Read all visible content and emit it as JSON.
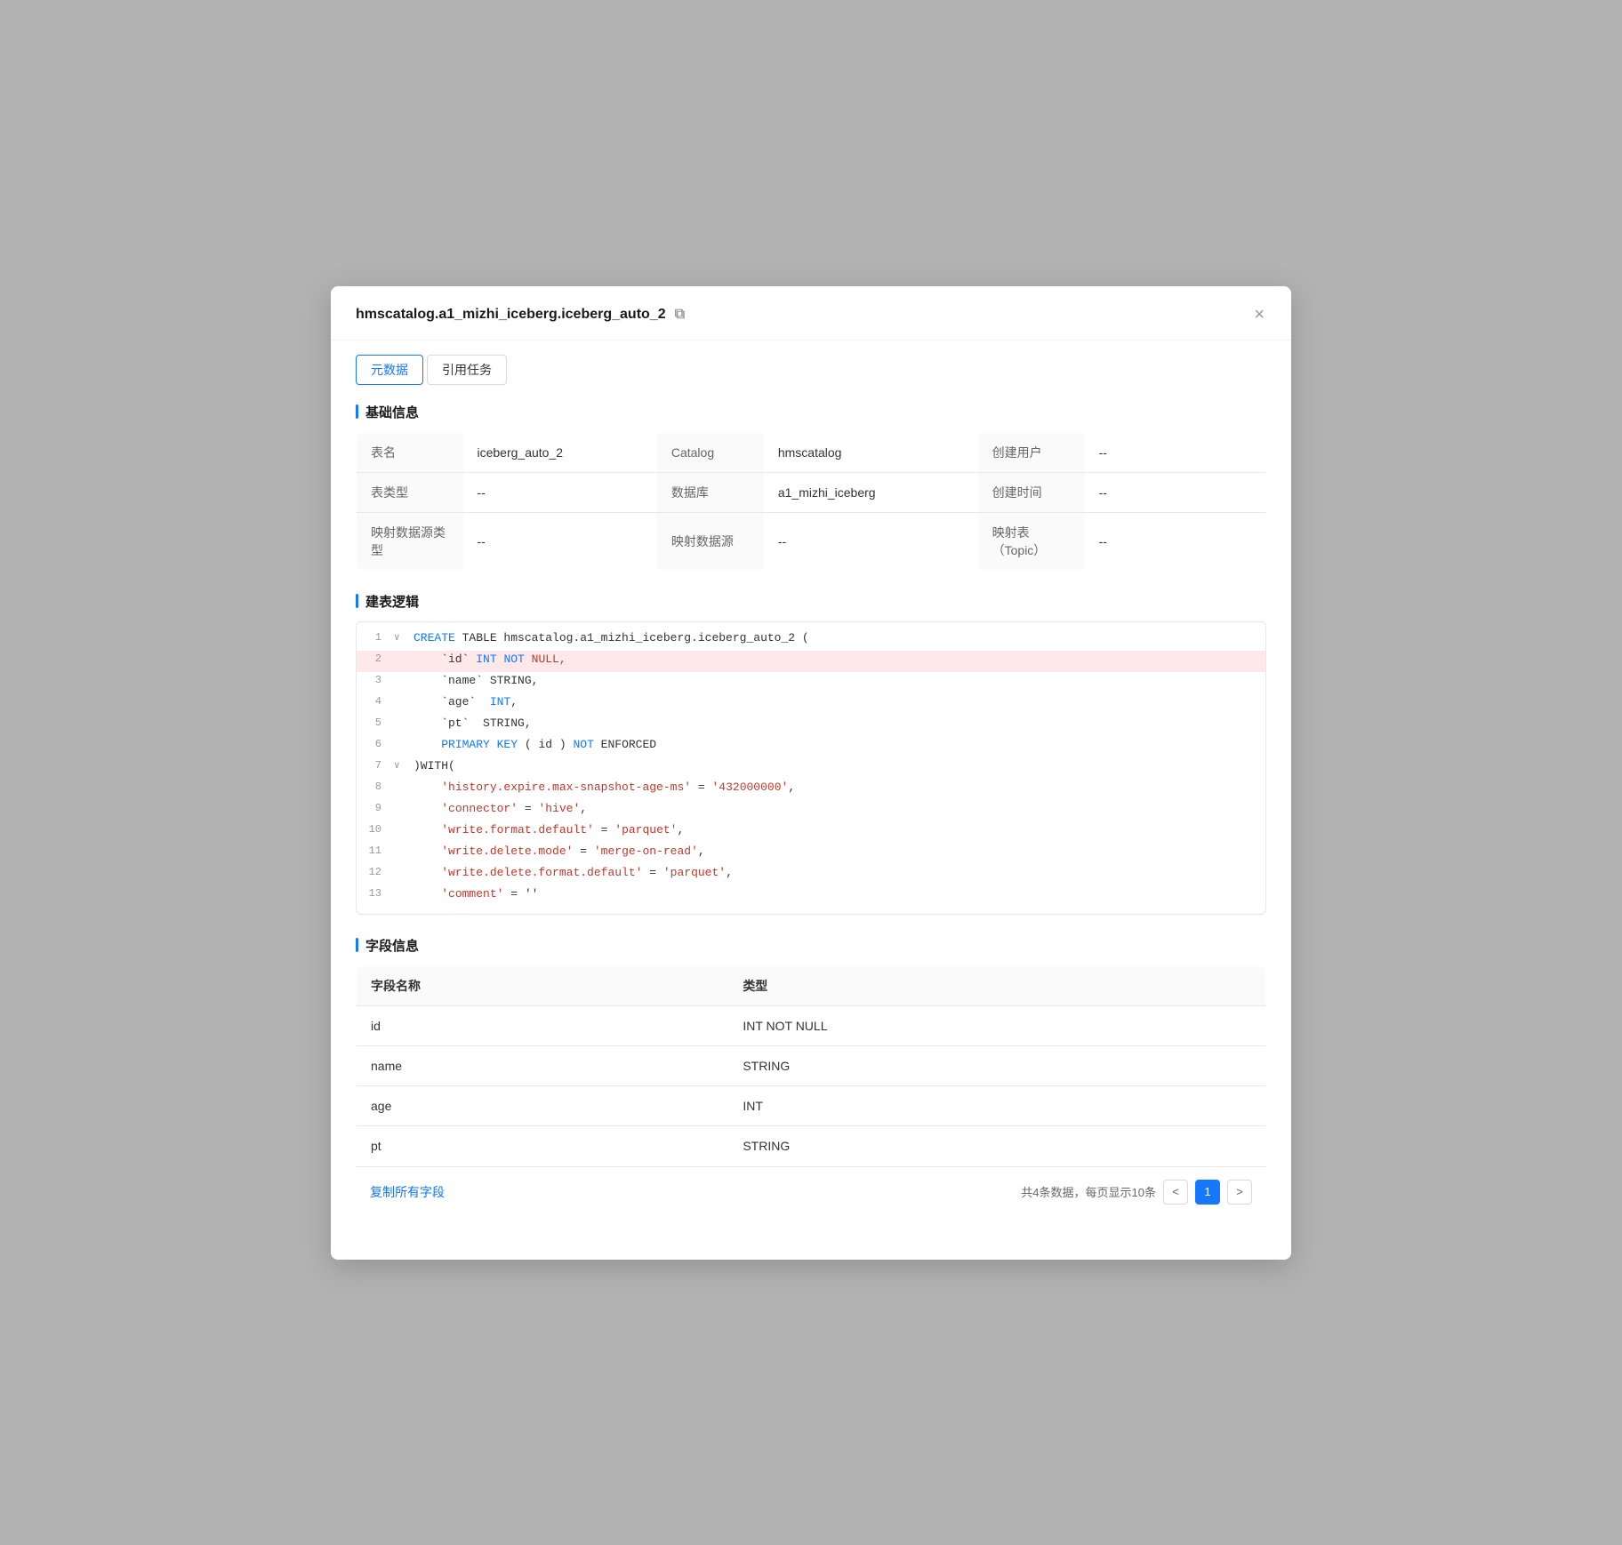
{
  "modal": {
    "title": "hmscatalog.a1_mizhi_iceberg.iceberg_auto_2",
    "close_label": "×"
  },
  "tabs": [
    {
      "id": "metadata",
      "label": "元数据",
      "active": true
    },
    {
      "id": "reference",
      "label": "引用任务",
      "active": false
    }
  ],
  "sections": {
    "basic_info": {
      "title": "基础信息",
      "rows": [
        [
          {
            "label": "表名",
            "value": "iceberg_auto_2"
          },
          {
            "label": "Catalog",
            "value": "hmscatalog"
          },
          {
            "label": "创建用户",
            "value": "--"
          }
        ],
        [
          {
            "label": "表类型",
            "value": "--"
          },
          {
            "label": "数据库",
            "value": "a1_mizhi_iceberg"
          },
          {
            "label": "创建时间",
            "value": "--"
          }
        ],
        [
          {
            "label": "映射数据源类型",
            "value": "--"
          },
          {
            "label": "映射数据源",
            "value": "--"
          },
          {
            "label": "映射表（Topic）",
            "value": "--"
          }
        ]
      ]
    },
    "ddl": {
      "title": "建表逻辑",
      "lines": [
        {
          "num": 1,
          "toggle": "∨",
          "content_parts": [
            {
              "text": "CREATE",
              "class": "kw-blue"
            },
            {
              "text": " TABLE hmscatalog.a1_mizhi_iceberg.iceberg_auto_2 (",
              "class": ""
            }
          ],
          "highlighted": false
        },
        {
          "num": 2,
          "toggle": "",
          "content_parts": [
            {
              "text": "    `id` ",
              "class": ""
            },
            {
              "text": "INT",
              "class": "kw-blue"
            },
            {
              "text": " ",
              "class": ""
            },
            {
              "text": "NOT",
              "class": "kw-blue"
            },
            {
              "text": " ",
              "class": ""
            },
            {
              "text": "NULL,",
              "class": "kw-red"
            }
          ],
          "highlighted": true
        },
        {
          "num": 3,
          "toggle": "",
          "content_parts": [
            {
              "text": "    `name` STRING,",
              "class": ""
            }
          ],
          "highlighted": false
        },
        {
          "num": 4,
          "toggle": "",
          "content_parts": [
            {
              "text": "    `age`  ",
              "class": ""
            },
            {
              "text": "INT",
              "class": "kw-blue"
            },
            {
              "text": ",",
              "class": ""
            }
          ],
          "highlighted": false
        },
        {
          "num": 5,
          "toggle": "",
          "content_parts": [
            {
              "text": "    `pt`  STRING,",
              "class": ""
            }
          ],
          "highlighted": false
        },
        {
          "num": 6,
          "toggle": "",
          "content_parts": [
            {
              "text": "    ",
              "class": ""
            },
            {
              "text": "PRIMARY KEY",
              "class": "kw-blue"
            },
            {
              "text": " ( id ) ",
              "class": ""
            },
            {
              "text": "NOT",
              "class": "kw-blue"
            },
            {
              "text": " ENFORCED",
              "class": ""
            }
          ],
          "highlighted": false
        },
        {
          "num": 7,
          "toggle": "∨",
          "content_parts": [
            {
              "text": ")WITH(",
              "class": ""
            }
          ],
          "highlighted": false
        },
        {
          "num": 8,
          "toggle": "",
          "content_parts": [
            {
              "text": "    ",
              "class": ""
            },
            {
              "text": "'history.expire.max-snapshot-age-ms'",
              "class": "kw-str"
            },
            {
              "text": " = ",
              "class": ""
            },
            {
              "text": "'432000000'",
              "class": "kw-str"
            },
            {
              "text": ",",
              "class": ""
            }
          ],
          "highlighted": false
        },
        {
          "num": 9,
          "toggle": "",
          "content_parts": [
            {
              "text": "    ",
              "class": ""
            },
            {
              "text": "'connector'",
              "class": "kw-str"
            },
            {
              "text": " = ",
              "class": ""
            },
            {
              "text": "'hive'",
              "class": "kw-str"
            },
            {
              "text": ",",
              "class": ""
            }
          ],
          "highlighted": false
        },
        {
          "num": 10,
          "toggle": "",
          "content_parts": [
            {
              "text": "    ",
              "class": ""
            },
            {
              "text": "'write.format.default'",
              "class": "kw-str"
            },
            {
              "text": " = ",
              "class": ""
            },
            {
              "text": "'parquet'",
              "class": "kw-str"
            },
            {
              "text": ",",
              "class": ""
            }
          ],
          "highlighted": false
        },
        {
          "num": 11,
          "toggle": "",
          "content_parts": [
            {
              "text": "    ",
              "class": ""
            },
            {
              "text": "'write.delete.mode'",
              "class": "kw-str"
            },
            {
              "text": " = ",
              "class": ""
            },
            {
              "text": "'merge-on-read'",
              "class": "kw-str"
            },
            {
              "text": ",",
              "class": ""
            }
          ],
          "highlighted": false
        },
        {
          "num": 12,
          "toggle": "",
          "content_parts": [
            {
              "text": "    ",
              "class": ""
            },
            {
              "text": "'write.delete.format.default'",
              "class": "kw-str"
            },
            {
              "text": " = ",
              "class": ""
            },
            {
              "text": "'parquet'",
              "class": "kw-str"
            },
            {
              "text": ",",
              "class": ""
            }
          ],
          "highlighted": false
        },
        {
          "num": 13,
          "toggle": "",
          "content_parts": [
            {
              "text": "    ",
              "class": ""
            },
            {
              "text": "'comment'",
              "class": "kw-str"
            },
            {
              "text": " = ''",
              "class": ""
            }
          ],
          "highlighted": false
        }
      ]
    },
    "fields": {
      "title": "字段信息",
      "columns": [
        "字段名称",
        "类型"
      ],
      "rows": [
        {
          "name": "id",
          "type": "INT NOT NULL"
        },
        {
          "name": "name",
          "type": "STRING"
        },
        {
          "name": "age",
          "type": "INT"
        },
        {
          "name": "pt",
          "type": "STRING"
        }
      ],
      "copy_label": "复制所有字段",
      "pagination": {
        "total_text": "共4条数据，每页显示10条",
        "current_page": 1,
        "prev_label": "<",
        "next_label": ">"
      }
    }
  }
}
